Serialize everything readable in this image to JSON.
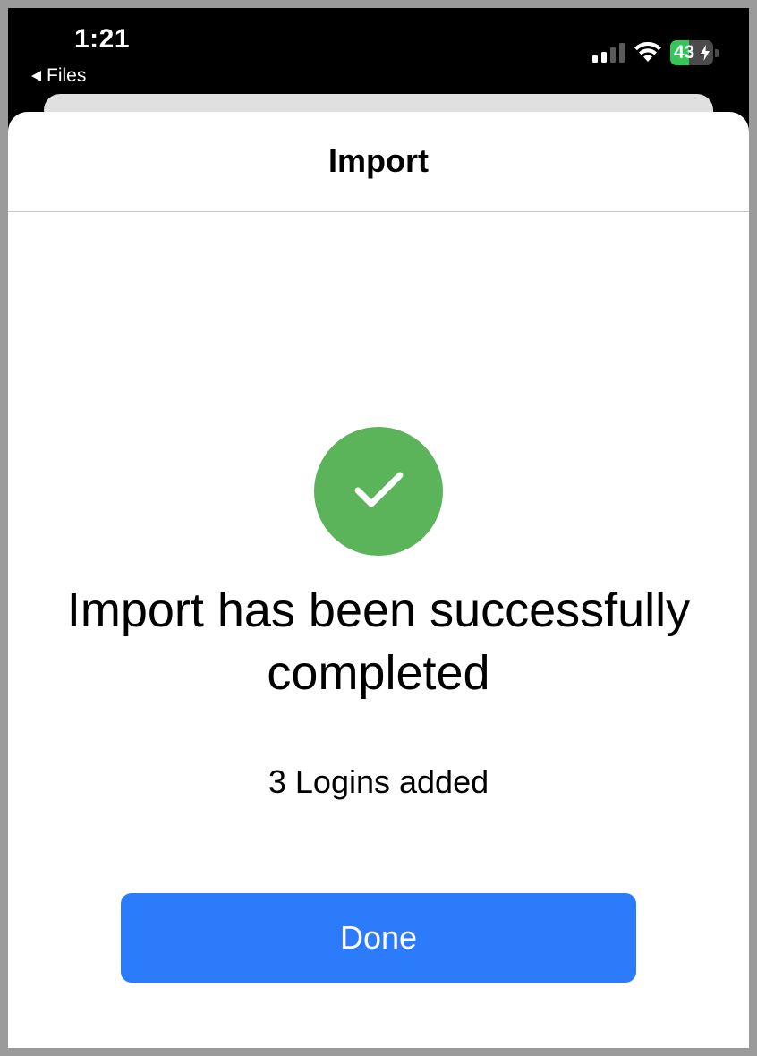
{
  "status_bar": {
    "time": "1:21",
    "back_label": "Files",
    "battery_level": "43",
    "battery_percent": 43,
    "battery_color": "#33c759",
    "icons": [
      "signal-icon",
      "wifi-icon",
      "battery-icon",
      "charging-bolt-icon"
    ]
  },
  "sheet": {
    "title": "Import"
  },
  "result": {
    "icon": "success-check-icon",
    "icon_color": "#5bb35a",
    "headline": "Import has been successfully completed",
    "detail": "3 Logins added"
  },
  "actions": {
    "done_label": "Done",
    "done_color": "#2c7bfb"
  }
}
